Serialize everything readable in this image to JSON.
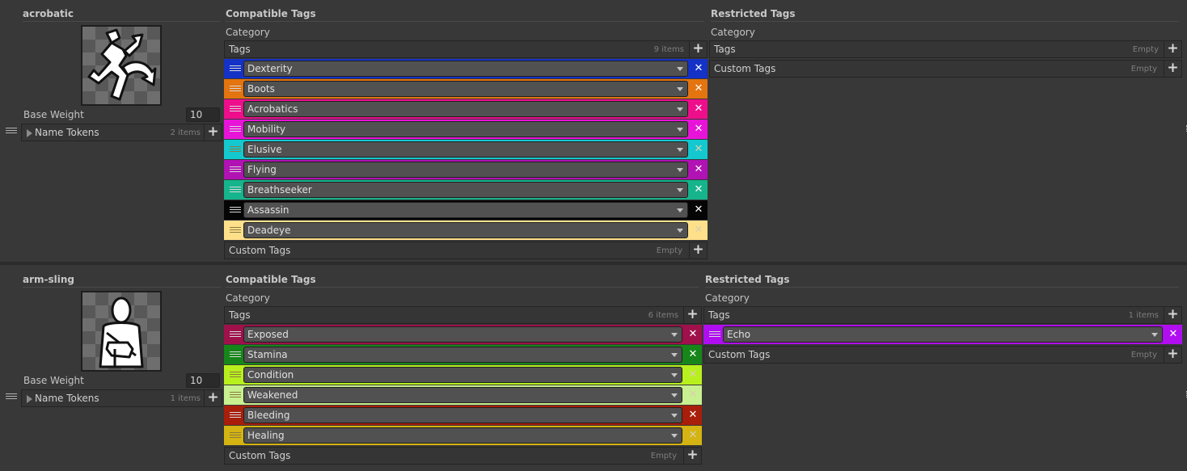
{
  "entries": [
    {
      "name": "acrobatic",
      "icon": "acrobat-figure-icon",
      "base_weight_label": "Base Weight",
      "base_weight": "10",
      "name_tokens_label": "Name Tokens",
      "name_tokens_count": "2 items",
      "compatible": {
        "title": "Compatible Tags",
        "category_label": "Category",
        "tags_label": "Tags",
        "tags_count": "9 items",
        "tags": [
          {
            "label": "Dexterity",
            "color": "#1432c8"
          },
          {
            "label": "Boots",
            "color": "#e3740f"
          },
          {
            "label": "Acrobatics",
            "color": "#ee0e8c"
          },
          {
            "label": "Mobility",
            "color": "#e813d8"
          },
          {
            "label": "Elusive",
            "color": "#14c8d0"
          },
          {
            "label": "Flying",
            "color": "#b012b4"
          },
          {
            "label": "Breathseeker",
            "color": "#16b48c"
          },
          {
            "label": "Assassin",
            "color": "#050505"
          },
          {
            "label": "Deadeye",
            "color": "#ffe08a"
          }
        ],
        "custom_tags_label": "Custom Tags",
        "custom_tags_count": "Empty"
      },
      "restricted": {
        "title": "Restricted Tags",
        "category_label": "Category",
        "tags_label": "Tags",
        "tags_count": "Empty",
        "tags": [],
        "custom_tags_label": "Custom Tags",
        "custom_tags_count": "Empty"
      }
    },
    {
      "name": "arm-sling",
      "icon": "arm-sling-figure-icon",
      "base_weight_label": "Base Weight",
      "base_weight": "10",
      "name_tokens_label": "Name Tokens",
      "name_tokens_count": "1 items",
      "compatible": {
        "title": "Compatible Tags",
        "category_label": "Category",
        "tags_label": "Tags",
        "tags_count": "6 items",
        "tags": [
          {
            "label": "Exposed",
            "color": "#a0104a"
          },
          {
            "label": "Stamina",
            "color": "#16861a"
          },
          {
            "label": "Condition",
            "color": "#b8f01e"
          },
          {
            "label": "Weakened",
            "color": "#c8f090"
          },
          {
            "label": "Bleeding",
            "color": "#a81e0a"
          },
          {
            "label": "Healing",
            "color": "#d4b412"
          }
        ],
        "custom_tags_label": "Custom Tags",
        "custom_tags_count": "Empty"
      },
      "restricted": {
        "title": "Restricted Tags",
        "category_label": "Category",
        "tags_label": "Tags",
        "tags_count": "1 items",
        "tags": [
          {
            "label": "Echo",
            "color": "#b00ef0"
          }
        ],
        "custom_tags_label": "Custom Tags",
        "custom_tags_count": "Empty"
      }
    }
  ],
  "icons": {
    "plus": "+",
    "remove": "✕"
  }
}
